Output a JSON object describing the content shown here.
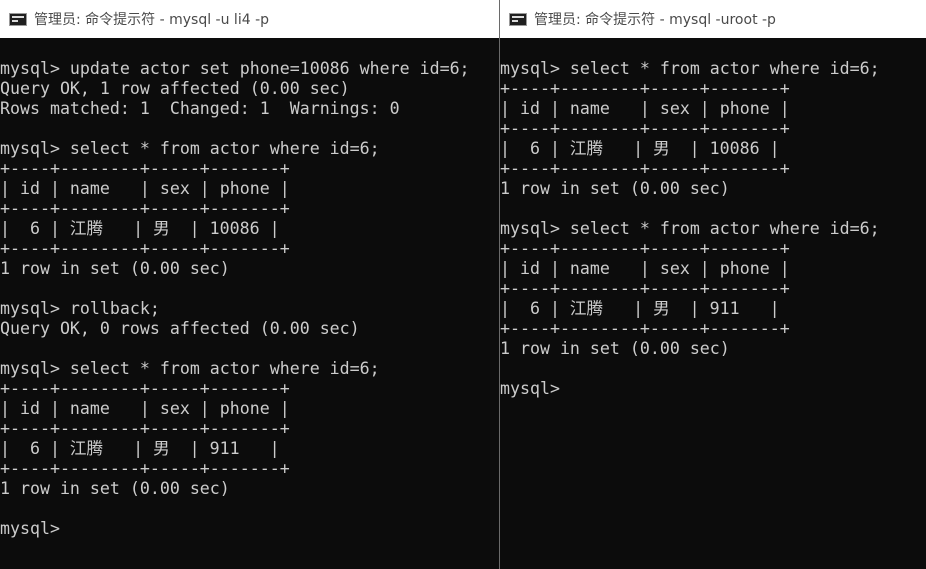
{
  "colors": {
    "terminal_bg": "#0c0c0c",
    "terminal_fg": "#cccccc",
    "titlebar_bg": "#ffffff",
    "titlebar_fg": "#4a4a4a"
  },
  "left_window": {
    "icon": "console-icon",
    "title": "管理员: 命令提示符 - mysql  -u li4 -p",
    "lines": [
      "mysql> update actor set phone=10086 where id=6;",
      "Query OK, 1 row affected (0.00 sec)",
      "Rows matched: 1  Changed: 1  Warnings: 0",
      "",
      "mysql> select * from actor where id=6;",
      "+----+--------+-----+-------+",
      "| id | name   | sex | phone |",
      "+----+--------+-----+-------+",
      "|  6 | 江腾   | 男  | 10086 |",
      "+----+--------+-----+-------+",
      "1 row in set (0.00 sec)",
      "",
      "mysql> rollback;",
      "Query OK, 0 rows affected (0.00 sec)",
      "",
      "mysql> select * from actor where id=6;",
      "+----+--------+-----+-------+",
      "| id | name   | sex | phone |",
      "+----+--------+-----+-------+",
      "|  6 | 江腾   | 男  | 911   |",
      "+----+--------+-----+-------+",
      "1 row in set (0.00 sec)",
      "",
      "mysql>"
    ]
  },
  "right_window": {
    "icon": "console-icon",
    "title": "管理员: 命令提示符 - mysql  -uroot -p",
    "lines": [
      "mysql> select * from actor where id=6;",
      "+----+--------+-----+-------+",
      "| id | name   | sex | phone |",
      "+----+--------+-----+-------+",
      "|  6 | 江腾   | 男  | 10086 |",
      "+----+--------+-----+-------+",
      "1 row in set (0.00 sec)",
      "",
      "mysql> select * from actor where id=6;",
      "+----+--------+-----+-------+",
      "| id | name   | sex | phone |",
      "+----+--------+-----+-------+",
      "|  6 | 江腾   | 男  | 911   |",
      "+----+--------+-----+-------+",
      "1 row in set (0.00 sec)",
      "",
      "mysql>"
    ]
  }
}
